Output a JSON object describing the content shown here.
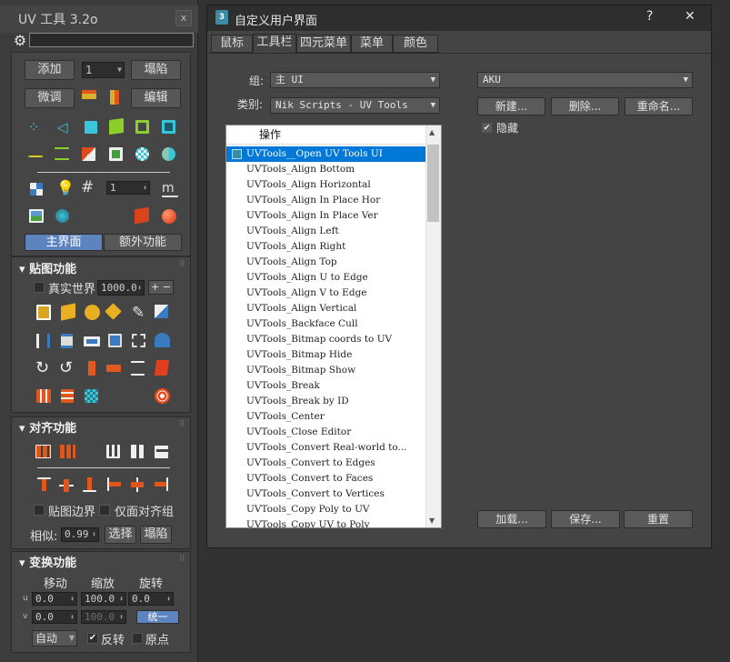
{
  "uv_panel": {
    "title": "UV 工具 3.2o",
    "close_label": "x",
    "top": {
      "add_label": "添加",
      "count_value": "1",
      "collapse_label": "塌陷",
      "tweak_label": "微调",
      "edit_label": "编辑",
      "grid_value": "1",
      "main_tab": "主界面",
      "extra_tab": "额外功能"
    },
    "map_section": {
      "title": "贴图功能",
      "real_world_label": "真实世界",
      "real_world_value": "1000.0",
      "plus_minus": "+ −"
    },
    "align_section": {
      "title": "对齐功能",
      "map_border_label": "贴图边界",
      "align_group_label": "仅面对齐组",
      "similar_label": "相似:",
      "similar_value": "0.99",
      "select_label": "选择",
      "collapse_label": "塌陷"
    },
    "transform_section": {
      "title": "变换功能",
      "move_label": "移动",
      "scale_label": "缩放",
      "rotate_label": "旋转",
      "u_label": "u",
      "v_label": "v",
      "u_move": "0.0",
      "u_scale": "100.0",
      "u_rotate": "0.0",
      "v_move": "0.0",
      "v_scale": "100.0",
      "unify_label": "统一",
      "auto_label": "自动",
      "flip_label": "反转",
      "origin_label": "原点"
    },
    "colors": {
      "accent": "#5e84c0",
      "orange": "#e0571e",
      "green": "#3fa03c",
      "cyan": "#3ac6d8",
      "yellow": "#e8c420"
    }
  },
  "dialog": {
    "title": "自定义用户界面",
    "help_label": "?",
    "close_label": "✕",
    "tabs": [
      "鼠标",
      "工具栏",
      "四元菜单",
      "菜单",
      "颜色"
    ],
    "active_tab": "工具栏",
    "group_label": "组:",
    "group_value": "主 UI",
    "category_label": "类别:",
    "category_value": "Nik Scripts - UV Tools",
    "toolbar_value": "AKU",
    "new_label": "新建...",
    "delete_label": "删除...",
    "rename_label": "重命名...",
    "hide_label": "隐藏",
    "load_label": "加载...",
    "save_label": "保存...",
    "reset_label": "重置",
    "list_header": "操作",
    "actions": [
      "UVTools__Open UV Tools UI",
      "UVTools_Align Bottom",
      "UVTools_Align Horizontal",
      "UVTools_Align In Place Hor",
      "UVTools_Align In Place Ver",
      "UVTools_Align Left",
      "UVTools_Align Right",
      "UVTools_Align Top",
      "UVTools_Align U to Edge",
      "UVTools_Align V to Edge",
      "UVTools_Align Vertical",
      "UVTools_Backface Cull",
      "UVTools_Bitmap coords to UV",
      "UVTools_Bitmap Hide",
      "UVTools_Bitmap Show",
      "UVTools_Break",
      "UVTools_Break by ID",
      "UVTools_Center",
      "UVTools_Close Editor",
      "UVTools_Convert Real-world to...",
      "UVTools_Convert to Edges",
      "UVTools_Convert to Faces",
      "UVTools_Convert to Vertices",
      "UVTools_Copy Poly to UV",
      "UVTools_Copy UV to Poly"
    ],
    "selected_index": 0
  }
}
